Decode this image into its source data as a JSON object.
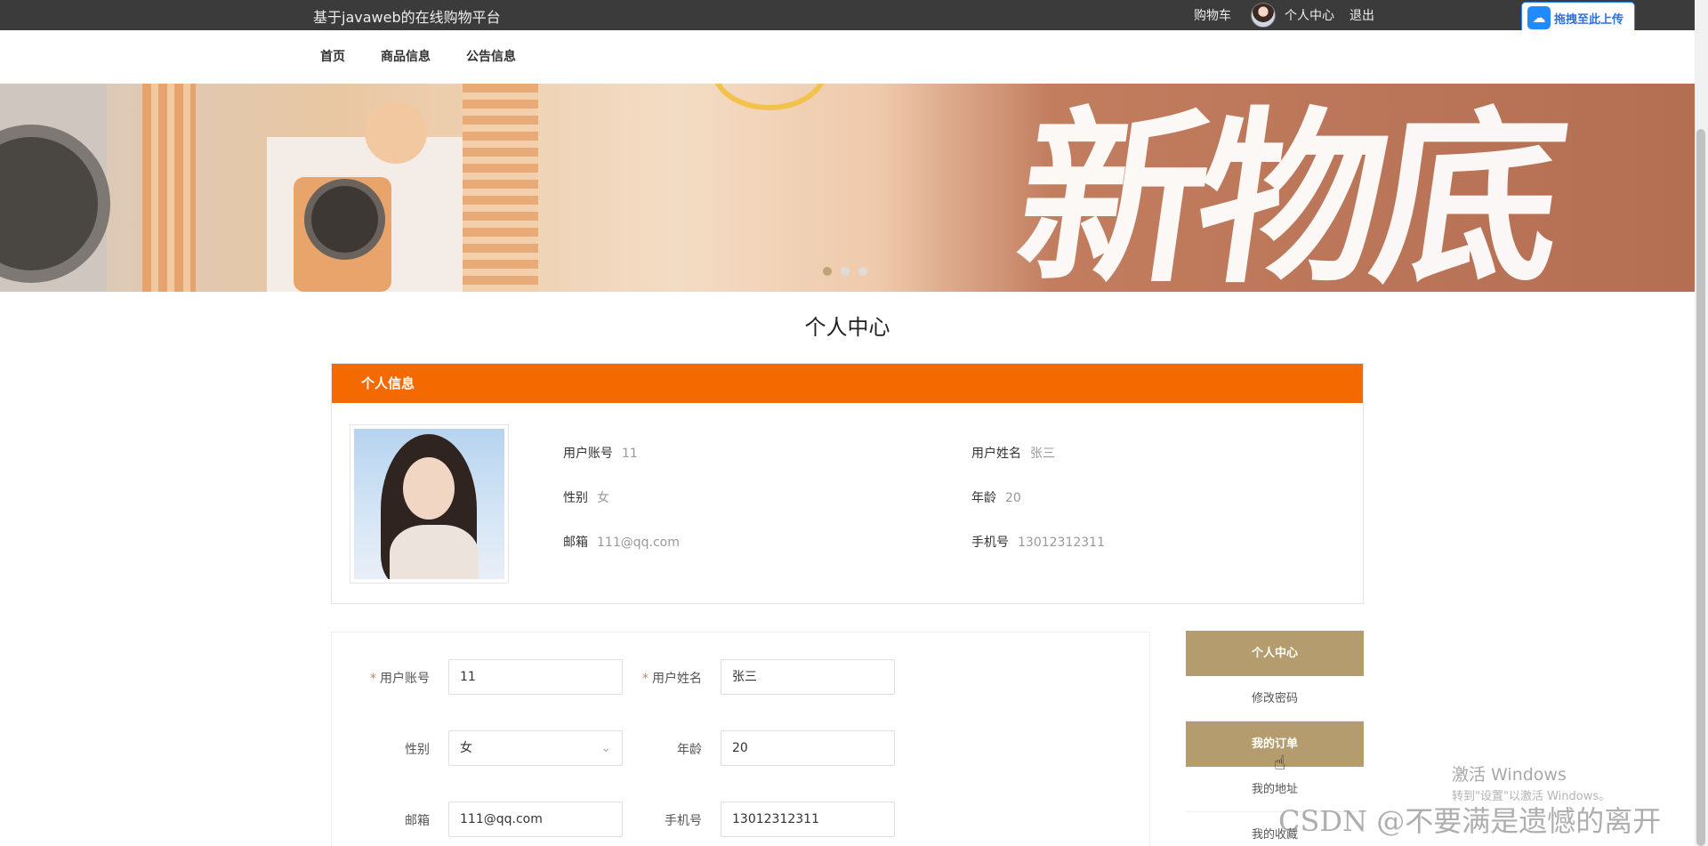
{
  "topbar": {
    "site_title": "基于javaweb的在线购物平台",
    "cart": "购物车",
    "personal_center": "个人中心",
    "logout": "退出",
    "upload_button": "拖拽至此上传"
  },
  "nav": {
    "items": [
      "首页",
      "商品信息",
      "公告信息"
    ]
  },
  "banner": {
    "brush_text": "新物底",
    "slide_count": 3,
    "active_slide": 1
  },
  "page_title": "个人中心",
  "info_card": {
    "header": "个人信息",
    "fields": [
      {
        "label": "用户账号",
        "value": "11"
      },
      {
        "label": "用户姓名",
        "value": "张三"
      },
      {
        "label": "性别",
        "value": "女"
      },
      {
        "label": "年龄",
        "value": "20"
      },
      {
        "label": "邮箱",
        "value": "111@qq.com"
      },
      {
        "label": "手机号",
        "value": "13012312311"
      }
    ]
  },
  "form": {
    "account_label": "用户账号",
    "account_value": "11",
    "name_label": "用户姓名",
    "name_value": "张三",
    "gender_label": "性别",
    "gender_value": "女",
    "age_label": "年龄",
    "age_value": "20",
    "email_label": "邮箱",
    "email_value": "111@qq.com",
    "phone_label": "手机号",
    "phone_value": "13012312311"
  },
  "side_menu": {
    "items": [
      {
        "label": "个人中心",
        "active": true
      },
      {
        "label": "修改密码",
        "active": false
      },
      {
        "label": "我的订单",
        "active": true
      },
      {
        "label": "我的地址",
        "active": false
      },
      {
        "label": "我的收藏",
        "active": false
      }
    ]
  },
  "watermarks": {
    "activate_title": "激活 Windows",
    "activate_sub": "转到\"设置\"以激活 Windows。",
    "csdn": "CSDN @不要满是遗憾的离开"
  },
  "colors": {
    "accent_orange": "#f56a00",
    "menu_gold": "#b49c6e",
    "topbar": "#3b3b3b"
  }
}
